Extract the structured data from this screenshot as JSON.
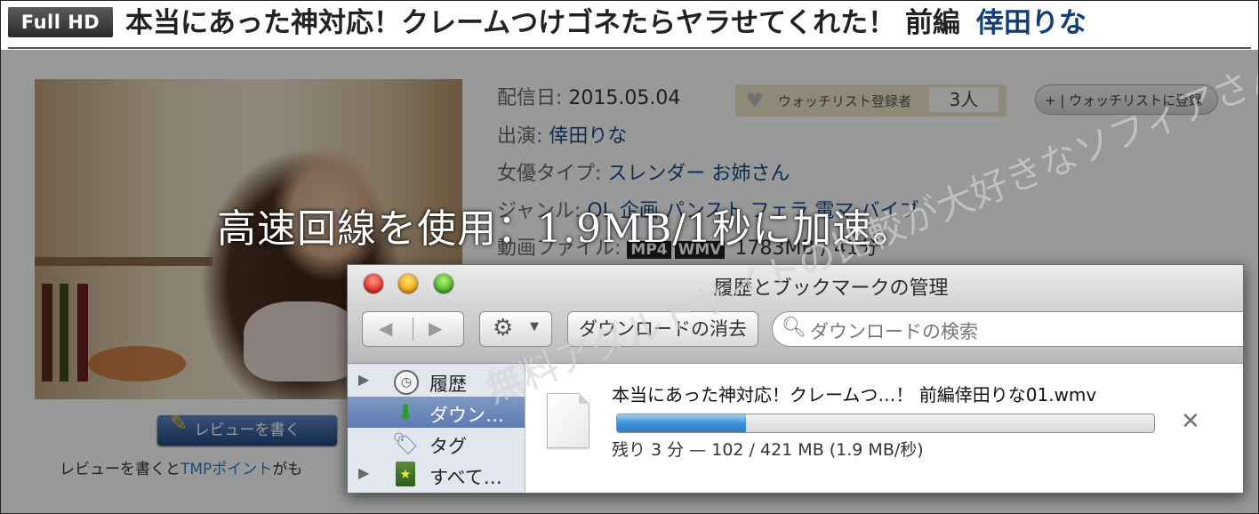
{
  "header": {
    "badge": "Full HD",
    "title": "本当にあった神対応！クレームつけゴネたらヤラせてくれた！ 前編",
    "actress": "倖田りな"
  },
  "details": {
    "date_label": "配信日:",
    "date_value": "2015.05.04",
    "cast_label": "出演:",
    "cast_value": "倖田りな",
    "type_label": "女優タイプ:",
    "type_value": "スレンダー お姉さん",
    "genre_label": "ジャンル:",
    "genre_value": "OL 企画 パンスト フェラ 電マ バイブ",
    "file_label": "動画ファイル:",
    "format_mp4": "MP4",
    "format_wmv": "WMV",
    "file_value": "1783MB / 41分"
  },
  "watchlist": {
    "label": "ウォッチリスト登録者",
    "count": "3人",
    "add_label": "+ | ウォッチリストに登録"
  },
  "review": {
    "button_label": "レビューを書く",
    "note_prefix": "レビューを書くと",
    "note_link": "TMPポイント",
    "note_suffix": "がも"
  },
  "overlay_caption": "高速回線を使用：1.9MB/1秒に加速。",
  "watermark": "無料アダルトサイトの比較が大好きなソフィアさん",
  "window": {
    "title": "履歴とブックマークの管理",
    "clear_button": "ダウンロードの消去",
    "search_placeholder": "ダウンロードの検索",
    "sidebar": [
      {
        "label": "履歴",
        "icon": "clock-icon"
      },
      {
        "label": "ダウン…",
        "icon": "download-arrow-icon",
        "selected": true
      },
      {
        "label": "タグ",
        "icon": "tag-icon"
      },
      {
        "label": "すべて…",
        "icon": "bookmarks-book-icon"
      }
    ],
    "download": {
      "filename": "本当にあった神対応！クレームつ…！ 前編倖田りな01.wmv",
      "progress_fraction": 0.24,
      "status": "残り 3 分 — 102 / 421 MB (1.9 MB/秒)"
    }
  },
  "colors": {
    "actress_link": "#143f74",
    "link_blue": "#1a4a88",
    "progress_blue": "#3f93d8",
    "sidebar_selected": "#5c7bb0"
  }
}
